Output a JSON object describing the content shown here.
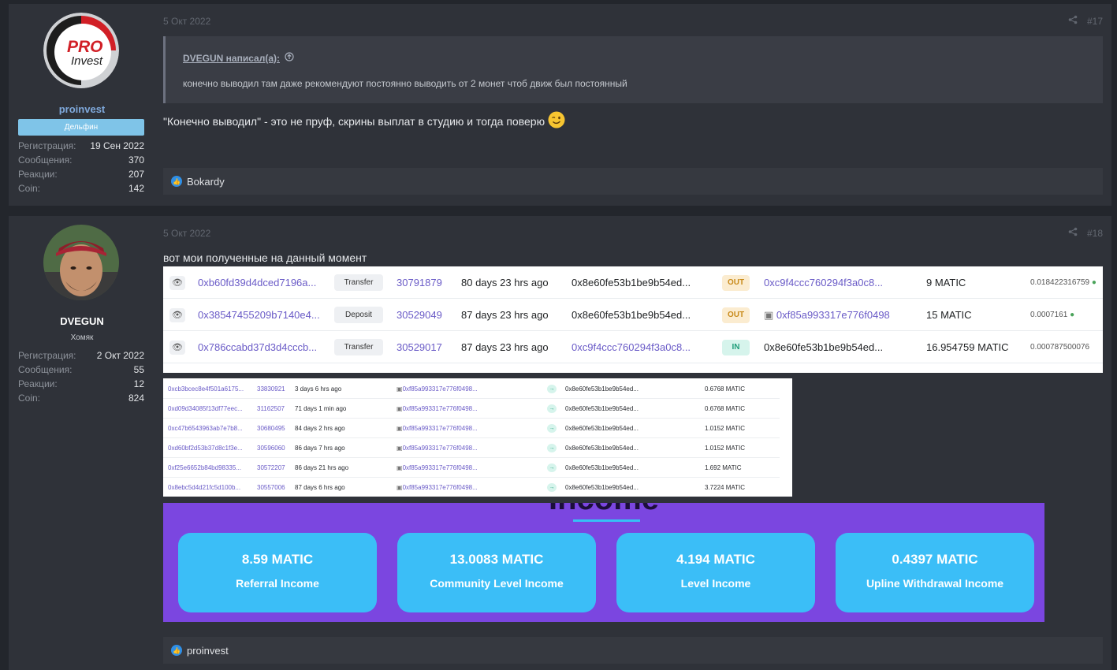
{
  "posts": [
    {
      "user": {
        "name": "proinvest",
        "rank": "Дельфин",
        "stats": [
          {
            "label": "Регистрация:",
            "value": "19 Сен 2022"
          },
          {
            "label": "Сообщения:",
            "value": "370"
          },
          {
            "label": "Реакции:",
            "value": "207"
          },
          {
            "label": "Coin:",
            "value": "142"
          }
        ]
      },
      "date": "5 Окт 2022",
      "number": "#17",
      "quote": {
        "author": "DVEGUN написал(а):",
        "text": "конечно выводил там даже рекомендуют постоянно выводить от 2 монет чтоб движ был постоянный"
      },
      "message": "\"Конечно выводил\" - это не пруф, скрины выплат в студию и тогда поверю",
      "reactions": "Bokardy"
    },
    {
      "user": {
        "name": "DVEGUN",
        "rank": "Хомяк",
        "stats": [
          {
            "label": "Регистрация:",
            "value": "2 Окт 2022"
          },
          {
            "label": "Сообщения:",
            "value": "55"
          },
          {
            "label": "Реакции:",
            "value": "12"
          },
          {
            "label": "Coin:",
            "value": "824"
          }
        ]
      },
      "date": "5 Окт 2022",
      "number": "#18",
      "message": "вот мои полученные на данный момент",
      "reactions": "proinvest"
    }
  ],
  "transactions": [
    {
      "hash": "0xb60fd39d4dced7196a...",
      "method": "Transfer",
      "block": "30791879",
      "age": "80 days 23 hrs ago",
      "from": "0x8e60fe53b1be9b54ed...",
      "dir": "OUT",
      "to": "0xc9f4ccc760294f3a0c8...",
      "value": "9 MATIC",
      "fee": "0.018422316759"
    },
    {
      "hash": "0x38547455209b7140e4...",
      "method": "Deposit",
      "block": "30529049",
      "age": "87 days 23 hrs ago",
      "from": "0x8e60fe53b1be9b54ed...",
      "dir": "OUT",
      "to": "0xf85a993317e776f0498...",
      "value": "15 MATIC",
      "fee": "0.0007161"
    },
    {
      "hash": "0x786ccabd37d3d4cccb...",
      "method": "Transfer",
      "block": "30529017",
      "age": "87 days 23 hrs ago",
      "from": "0xc9f4ccc760294f3a0c8...",
      "dir": "IN",
      "to": "0x8e60fe53b1be9b54ed...",
      "value": "16.954759 MATIC",
      "fee": "0.000787500076"
    }
  ],
  "internal_txs": [
    {
      "hash": "0xcb3bcec8e4f501a6175...",
      "block": "33830921",
      "age": "3 days 6 hrs ago",
      "from": "0xf85a993317e776f0498...",
      "to": "0x8e60fe53b1be9b54ed...",
      "value": "0.6768 MATIC"
    },
    {
      "hash": "0xd09d34085f13df77eec...",
      "block": "31162507",
      "age": "71 days 1 min ago",
      "from": "0xf85a993317e776f0498...",
      "to": "0x8e60fe53b1be9b54ed...",
      "value": "0.6768 MATIC"
    },
    {
      "hash": "0xc47b6543963ab7e7b8...",
      "block": "30680495",
      "age": "84 days 2 hrs ago",
      "from": "0xf85a993317e776f0498...",
      "to": "0x8e60fe53b1be9b54ed...",
      "value": "1.0152 MATIC"
    },
    {
      "hash": "0xd60bf2d53b37d8c1f3e...",
      "block": "30596060",
      "age": "86 days 7 hrs ago",
      "from": "0xf85a993317e776f0498...",
      "to": "0x8e60fe53b1be9b54ed...",
      "value": "1.0152 MATIC"
    },
    {
      "hash": "0xf25e6652b84bd98335...",
      "block": "30572207",
      "age": "86 days 21 hrs ago",
      "from": "0xf85a993317e776f0498...",
      "to": "0x8e60fe53b1be9b54ed...",
      "value": "1.692 MATIC"
    },
    {
      "hash": "0x8ebc5d4d21fc5d100b...",
      "block": "30557006",
      "age": "87 days 6 hrs ago",
      "from": "0xf85a993317e776f0498...",
      "to": "0x8e60fe53b1be9b54ed...",
      "value": "3.7224 MATIC"
    }
  ],
  "income": {
    "title": "Income",
    "cards": [
      {
        "value": "8.59 MATIC",
        "label": "Referral Income"
      },
      {
        "value": "13.0083 MATIC",
        "label": "Community Level Income"
      },
      {
        "value": "4.194 MATIC",
        "label": "Level Income"
      },
      {
        "value": "0.4397 MATIC",
        "label": "Upline Withdrawal Income"
      }
    ]
  },
  "logo": {
    "line1": "PRO",
    "line2": "Invest"
  },
  "colors": {
    "accent": "#6a5bc7",
    "income_bg": "#7b46e0",
    "card_bg": "#3bbef7",
    "rank_badge": "#7fc4e8"
  },
  "icons": {
    "share": "share-icon",
    "like": "like-icon",
    "wink": "wink-emoji-icon",
    "quote_jump": "arrow-up-circle-icon"
  }
}
